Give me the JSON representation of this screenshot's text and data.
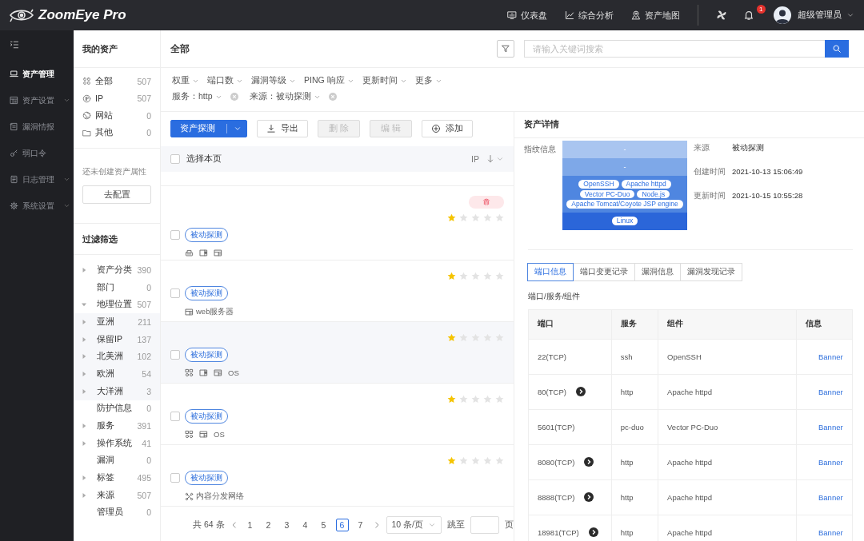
{
  "header": {
    "logo": "ZoomEye Pro",
    "nav": [
      {
        "label": "仪表盘",
        "kind": "dashboard"
      },
      {
        "label": "综合分析",
        "kind": "analysis"
      },
      {
        "label": "资产地图",
        "kind": "map"
      }
    ],
    "notifications": "1",
    "user": "超级管理员"
  },
  "sidebar": {
    "items": [
      {
        "label": "资产管理",
        "kind": "laptop",
        "selected": true,
        "submenu": false
      },
      {
        "label": "资产设置",
        "kind": "grid",
        "selected": false,
        "submenu": true
      },
      {
        "label": "漏洞情报",
        "kind": "doc",
        "selected": false,
        "submenu": false
      },
      {
        "label": "弱口令",
        "kind": "key",
        "selected": false,
        "submenu": false
      },
      {
        "label": "日志管理",
        "kind": "log",
        "selected": false,
        "submenu": true
      },
      {
        "label": "系统设置",
        "kind": "gear",
        "selected": false,
        "submenu": true
      }
    ]
  },
  "assets_panel": {
    "title": "我的资产",
    "categories": [
      {
        "label": "全部",
        "count": "507",
        "kind": "all"
      },
      {
        "label": "IP",
        "count": "507",
        "kind": "ip"
      },
      {
        "label": "网站",
        "count": "0",
        "kind": "site"
      },
      {
        "label": "其他",
        "count": "0",
        "kind": "other"
      }
    ],
    "empty_note": "还未创建资产属性",
    "config_button": "去配置",
    "filter_title": "过滤筛选",
    "filters": [
      {
        "label": "资产分类",
        "count": "390",
        "kind": "group",
        "expanded": false
      },
      {
        "label": "部门",
        "count": "0",
        "kind": "leaf"
      },
      {
        "label": "地理位置",
        "count": "507",
        "kind": "group",
        "expanded": true,
        "children": [
          {
            "label": "亚洲",
            "count": "211",
            "kind": "group",
            "expanded": false
          },
          {
            "label": "保留IP",
            "count": "137",
            "kind": "group",
            "expanded": false
          },
          {
            "label": "北美洲",
            "count": "102",
            "kind": "group",
            "expanded": false
          },
          {
            "label": "欧洲",
            "count": "54",
            "kind": "group",
            "expanded": false
          },
          {
            "label": "大洋洲",
            "count": "3",
            "kind": "group",
            "expanded": false
          }
        ]
      },
      {
        "label": "防护信息",
        "count": "0",
        "kind": "leaf"
      },
      {
        "label": "服务",
        "count": "391",
        "kind": "group",
        "expanded": false
      },
      {
        "label": "操作系统",
        "count": "41",
        "kind": "group",
        "expanded": false
      },
      {
        "label": "漏洞",
        "count": "0",
        "kind": "leaf"
      },
      {
        "label": "标签",
        "count": "495",
        "kind": "group",
        "expanded": false
      },
      {
        "label": "来源",
        "count": "507",
        "kind": "group",
        "expanded": false
      },
      {
        "label": "管理员",
        "count": "0",
        "kind": "leaf"
      }
    ]
  },
  "main": {
    "title": "全部",
    "search": {
      "placeholder": "请输入关键词搜索"
    },
    "dropdowns": [
      "权重",
      "端口数",
      "漏洞等级",
      "PING 响应",
      "更新时间",
      "更多"
    ],
    "active_filters": [
      {
        "label": "服务：http"
      },
      {
        "label": "来源：被动探测"
      }
    ],
    "toolbar": [
      {
        "label": "资产探测",
        "kind": "split",
        "disabled": false
      },
      {
        "label": "导出",
        "kind": "export",
        "disabled": false
      },
      {
        "label": "删 除",
        "kind": "plain",
        "disabled": true
      },
      {
        "label": "编 辑",
        "kind": "plain",
        "disabled": true
      },
      {
        "label": "添加",
        "kind": "add",
        "disabled": false
      }
    ],
    "select_all": {
      "label": "选择本页",
      "checked": false
    },
    "sort": {
      "label": "IP"
    },
    "rows": [
      {
        "checked": false,
        "highlighted": false,
        "alert": true,
        "stars": 1,
        "tag": "被动探测",
        "features": [
          {
            "kind": "device"
          },
          {
            "kind": "panel"
          },
          {
            "kind": "window"
          }
        ]
      },
      {
        "checked": false,
        "highlighted": false,
        "alert": false,
        "stars": 1,
        "tag": "被动探测",
        "features": [
          {
            "kind": "window",
            "label": "web服务器"
          }
        ]
      },
      {
        "checked": false,
        "highlighted": true,
        "alert": false,
        "stars": 1,
        "tag": "被动探测",
        "features": [
          {
            "kind": "nodes"
          },
          {
            "kind": "panel"
          },
          {
            "kind": "window"
          },
          {
            "kind": "text",
            "label": "OS"
          }
        ]
      },
      {
        "checked": false,
        "highlighted": false,
        "alert": false,
        "stars": 1,
        "tag": "被动探测",
        "features": [
          {
            "kind": "nodes"
          },
          {
            "kind": "window"
          },
          {
            "kind": "text",
            "label": "OS"
          }
        ]
      },
      {
        "checked": false,
        "highlighted": false,
        "alert": false,
        "stars": 1,
        "tag": "被动探测",
        "features": [
          {
            "kind": "network",
            "label": "内容分发网络"
          }
        ]
      }
    ],
    "pagination": {
      "total": "共 64 条",
      "pages": [
        {
          "label": "1",
          "selected": false
        },
        {
          "label": "2",
          "selected": false
        },
        {
          "label": "3",
          "selected": false
        },
        {
          "label": "4",
          "selected": false
        },
        {
          "label": "5",
          "selected": false
        },
        {
          "label": "6",
          "selected": true
        },
        {
          "label": "7",
          "selected": false
        }
      ],
      "page_size": "10 条/页",
      "jump_label": "跳至",
      "page_unit": "页"
    }
  },
  "detail": {
    "title": "资产详情",
    "fingerprint_label": "指纹信息",
    "layers": [
      {
        "color": "#a9c5f0",
        "label": "-"
      },
      {
        "color": "#7ea8e8",
        "label": "-"
      },
      {
        "color": "#4f86e0",
        "tags": [
          "OpenSSH",
          "Apache httpd",
          "Vector PC-Duo",
          "Node.js",
          "Apache Tomcat/Coyote JSP engine"
        ]
      },
      {
        "color": "#2b66d9",
        "tags": [
          "Linux"
        ]
      }
    ],
    "info": [
      {
        "label": "来源",
        "value": "被动探测"
      },
      {
        "label": "创建时间",
        "value": "2021-10-13 15:06:49"
      },
      {
        "label": "更新时间",
        "value": "2021-10-15 10:55:28"
      }
    ],
    "tabs": [
      {
        "label": "端口信息",
        "selected": true
      },
      {
        "label": "端口变更记录",
        "selected": false
      },
      {
        "label": "漏洞信息",
        "selected": false
      },
      {
        "label": "漏洞发现记录",
        "selected": false
      }
    ],
    "section_title": "端口/服务/组件",
    "table": {
      "columns": [
        "端口",
        "服务",
        "组件",
        "信息"
      ],
      "rows": [
        {
          "port": "22(TCP)",
          "jump": false,
          "service": "ssh",
          "component": "OpenSSH",
          "info": "Banner"
        },
        {
          "port": "80(TCP)",
          "jump": true,
          "service": "http",
          "component": "Apache httpd",
          "info": "Banner"
        },
        {
          "port": "5601(TCP)",
          "jump": false,
          "service": "pc-duo",
          "component": "Vector PC-Duo",
          "info": "Banner"
        },
        {
          "port": "8080(TCP)",
          "jump": true,
          "service": "http",
          "component": "Apache httpd",
          "info": "Banner"
        },
        {
          "port": "8888(TCP)",
          "jump": true,
          "service": "http",
          "component": "Apache httpd",
          "info": "Banner"
        },
        {
          "port": "18981(TCP)",
          "jump": true,
          "service": "http",
          "component": "Apache httpd",
          "info": "Banner"
        }
      ]
    }
  }
}
